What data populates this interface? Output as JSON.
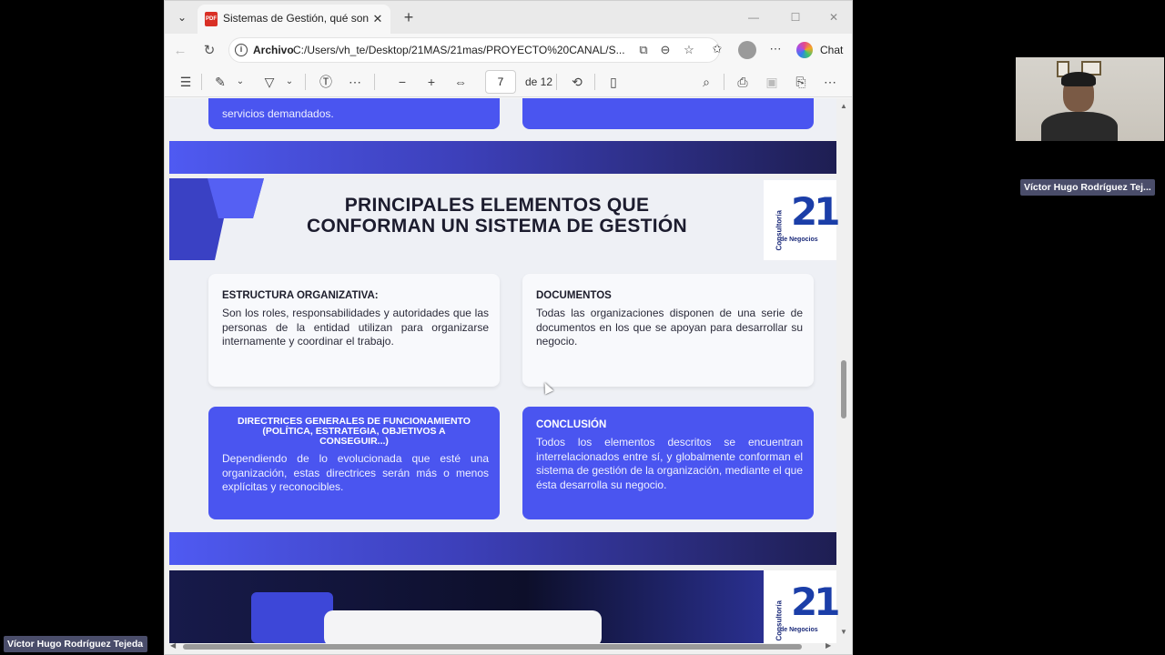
{
  "tab": {
    "title": "Sistemas de Gestión, qué son, actu",
    "favicon": "PDF"
  },
  "address": {
    "label": "Archivo",
    "url": "C:/Users/vh_te/Desktop/21MAS/21mas/PROYECTO%20CANAL/S..."
  },
  "chat_label": "Chat",
  "pdf_toolbar": {
    "page_current": "7",
    "page_total": "de 12"
  },
  "page_top": {
    "card_left_text": "servicios demandados."
  },
  "slide": {
    "heading_line1": "PRINCIPALES ELEMENTOS QUE",
    "heading_line2": "CONFORMAN UN SISTEMA DE GESTIÓN",
    "logo_number": "21",
    "logo_vertical": "Consultoría",
    "logo_sub": "de Negocios",
    "cards": {
      "estructura_title": "ESTRUCTURA ORGANIZATIVA:",
      "estructura_text": " Son los roles, responsabilidades y autoridades que las personas de la entidad utilizan para organizarse internamente y coordinar el trabajo.",
      "documentos_title": "DOCUMENTOS",
      "documentos_text": "Todas las organizaciones disponen de una serie de documentos en los que se apoyan para desarrollar su negocio.",
      "directrices_title": "DIRECTRICES GENERALES DE FUNCIONAMIENTO (POLÍTICA, ESTRATEGIA, OBJETIVOS A CONSEGUIR...)",
      "directrices_text": "Dependiendo de lo evolucionada que esté una organización, estas directrices serán más o menos explícitas y reconocibles.",
      "conclusion_title": "CONCLUSIÓN",
      "conclusion_text": "Todos los elementos descritos se encuentran interrelacionados entre sí, y globalmente conforman el sistema de gestión de la organización, mediante el que ésta desarrolla su negocio."
    }
  },
  "video": {
    "participant_label": "Víctor Hugo Rodríguez Tej...",
    "self_label": "Víctor Hugo Rodríguez Tejeda"
  },
  "colors": {
    "accent_blue": "#4a55f0",
    "band_dark": "#1e1e52"
  }
}
